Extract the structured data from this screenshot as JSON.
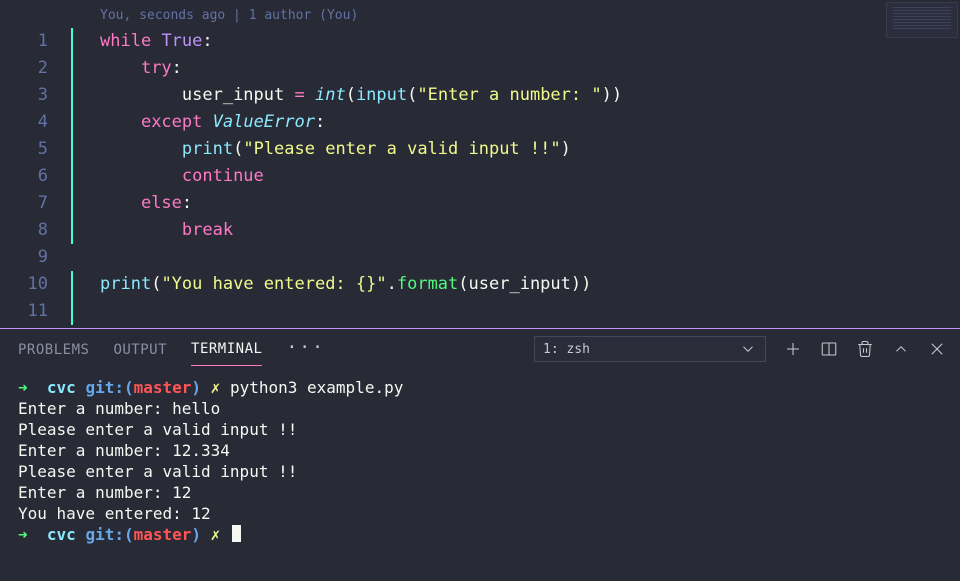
{
  "editor": {
    "code_lens": "You, seconds ago | 1 author (You)",
    "line_numbers": [
      "1",
      "2",
      "3",
      "4",
      "5",
      "6",
      "7",
      "8",
      "9",
      "10",
      "11"
    ],
    "code": {
      "l1": {
        "while": "while",
        "true": "True",
        "colon": ":"
      },
      "l2": {
        "try": "try",
        "colon": ":"
      },
      "l3": {
        "var": "user_input",
        "eq": " = ",
        "int": "int",
        "lp1": "(",
        "input": "input",
        "lp2": "(",
        "str": "\"Enter a number: \"",
        "rp2": ")",
        "rp1": ")"
      },
      "l4": {
        "except": "except",
        "err": "ValueError",
        "colon": ":"
      },
      "l5": {
        "print": "print",
        "lp": "(",
        "str": "\"Please enter a valid input !!\"",
        "rp": ")"
      },
      "l6": {
        "continue": "continue"
      },
      "l7": {
        "else": "else",
        "colon": ":"
      },
      "l8": {
        "break": "break"
      },
      "l10": {
        "print": "print",
        "lp": "(",
        "str": "\"You have entered: {}\"",
        "dot": ".",
        "format": "format",
        "lp2": "(",
        "arg": "user_input",
        "rp2": ")",
        "rp": ")"
      }
    }
  },
  "panel": {
    "tabs": {
      "problems": "PROBLEMS",
      "output": "OUTPUT",
      "terminal": "TERMINAL",
      "more": "···"
    },
    "terminal_selector": "1: zsh"
  },
  "terminal": {
    "prompt": {
      "arrow": "➜  ",
      "dir": "cvc ",
      "git_label": "git:(",
      "branch": "master",
      "git_close": ")",
      "dirty": " ✗ "
    },
    "cmd1": "python3 example.py",
    "out": [
      "Enter a number: hello",
      "Please enter a valid input !!",
      "Enter a number: 12.334",
      "Please enter a valid input !!",
      "Enter a number: 12",
      "You have entered: 12"
    ]
  }
}
